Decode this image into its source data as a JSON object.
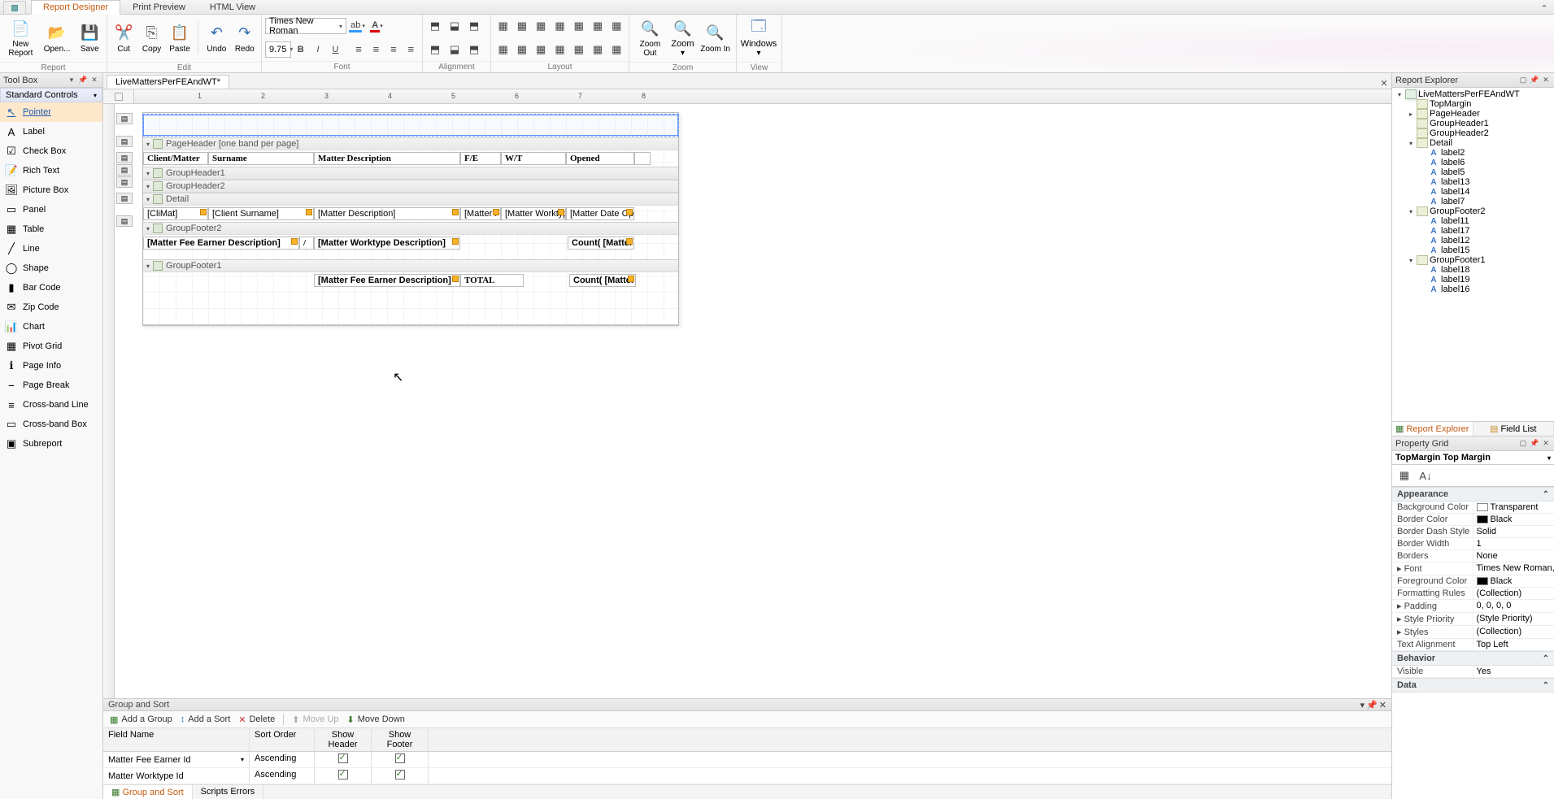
{
  "top_tabs": {
    "designer": "Report Designer",
    "preview": "Print Preview",
    "html": "HTML View"
  },
  "ribbon": {
    "report": {
      "label": "Report",
      "new": "New Report",
      "open": "Open...",
      "save": "Save"
    },
    "edit": {
      "label": "Edit",
      "cut": "Cut",
      "copy": "Copy",
      "paste": "Paste",
      "undo": "Undo",
      "redo": "Redo"
    },
    "font": {
      "label": "Font",
      "name": "Times New Roman",
      "size": "9.75"
    },
    "alignment": {
      "label": "Alignment"
    },
    "layout": {
      "label": "Layout"
    },
    "zoom": {
      "label": "Zoom",
      "out": "Zoom Out",
      "z": "Zoom",
      "in": "Zoom In"
    },
    "view": {
      "label": "View",
      "windows": "Windows"
    }
  },
  "toolbox": {
    "title": "Tool Box",
    "group": "Standard Controls",
    "items": [
      "Pointer",
      "Label",
      "Check Box",
      "Rich Text",
      "Picture Box",
      "Panel",
      "Table",
      "Line",
      "Shape",
      "Bar Code",
      "Zip Code",
      "Chart",
      "Pivot Grid",
      "Page Info",
      "Page Break",
      "Cross-band Line",
      "Cross-band Box",
      "Subreport"
    ]
  },
  "doc_tab": "LiveMattersPerFEAndWT*",
  "report": {
    "bands": {
      "page_header": {
        "title": "PageHeader [one band per page]",
        "cells": [
          "Client/Matter",
          "Surname",
          "Matter Description",
          "F/E",
          "W/T",
          "Opened"
        ]
      },
      "group_header1": {
        "title": "GroupHeader1"
      },
      "group_header2": {
        "title": "GroupHeader2"
      },
      "detail": {
        "title": "Detail",
        "cells": [
          "[CliMat]",
          "[Client Surname]",
          "[Matter Description]",
          "[Matter Fe",
          "[Matter Worktyp",
          "[Matter Date Op"
        ]
      },
      "group_footer2": {
        "title": "GroupFooter2",
        "cells": [
          "[Matter Fee Earner Description]",
          "/",
          "[Matter Worktype Description]",
          "Count( [Matter"
        ]
      },
      "group_footer1": {
        "title": "GroupFooter1",
        "cells": [
          "[Matter Fee Earner Description]",
          "TOTAL",
          "Count( [Matter"
        ]
      }
    }
  },
  "group_sort": {
    "title": "Group and Sort",
    "tools": {
      "add_group": "Add a Group",
      "add_sort": "Add a Sort",
      "delete": "Delete",
      "move_up": "Move Up",
      "move_down": "Move Down"
    },
    "cols": {
      "field": "Field Name",
      "sort": "Sort Order",
      "header": "Show Header",
      "footer": "Show Footer"
    },
    "rows": [
      {
        "field": "Matter Fee Earner Id",
        "sort": "Ascending",
        "header": true,
        "footer": true
      },
      {
        "field": "Matter Worktype Id",
        "sort": "Ascending",
        "header": true,
        "footer": true
      }
    ],
    "bottom_tabs": {
      "gs": "Group and Sort",
      "se": "Scripts Errors"
    }
  },
  "explorer": {
    "title": "Report Explorer",
    "root": "LiveMattersPerFEAndWT",
    "nodes": {
      "topmargin": "TopMargin",
      "pageheader": "PageHeader",
      "gh1": "GroupHeader1",
      "gh2": "GroupHeader2",
      "detail": "Detail",
      "gf2": "GroupFooter2",
      "gf1": "GroupFooter1",
      "labels_detail": [
        "label2",
        "label6",
        "label5",
        "label13",
        "label14",
        "label7"
      ],
      "labels_gf2": [
        "label11",
        "label17",
        "label12",
        "label15"
      ],
      "labels_gf1": [
        "label18",
        "label19",
        "label16"
      ]
    },
    "tabs": {
      "re": "Report Explorer",
      "fl": "Field List"
    }
  },
  "propgrid": {
    "title": "Property Grid",
    "selected": "TopMargin   Top Margin",
    "cats": {
      "appearance": "Appearance",
      "behavior": "Behavior",
      "data": "Data"
    },
    "props": {
      "background": "Background Color",
      "background_v": "Transparent",
      "border_color": "Border Color",
      "border_color_v": "Black",
      "border_dash": "Border Dash Style",
      "border_dash_v": "Solid",
      "border_width": "Border Width",
      "border_width_v": "1",
      "borders": "Borders",
      "borders_v": "None",
      "font": "Font",
      "font_v": "Times New Roman,...",
      "foreground": "Foreground Color",
      "foreground_v": "Black",
      "fmt_rule": "Formatting Rules",
      "fmt_rule_v": "(Collection)",
      "padding": "Padding",
      "padding_v": "0, 0, 0, 0",
      "style_pri": "Style Priority",
      "style_pri_v": "(Style Priority)",
      "styles": "Styles",
      "styles_v": "(Collection)",
      "text_align": "Text Alignment",
      "text_align_v": "Top Left",
      "visible": "Visible",
      "visible_v": "Yes"
    }
  },
  "ruler_marks": [
    "1",
    "2",
    "3",
    "4",
    "5",
    "6",
    "7",
    "8"
  ]
}
